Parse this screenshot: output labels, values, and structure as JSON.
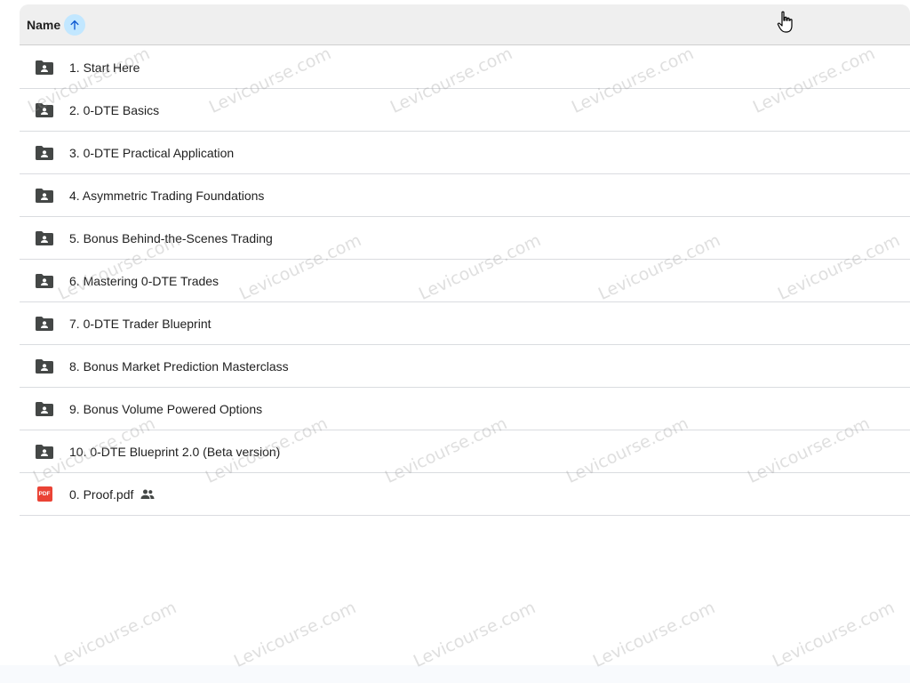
{
  "header": {
    "name_label": "Name"
  },
  "files": [
    {
      "name": "1. Start Here",
      "type": "shared-folder"
    },
    {
      "name": "2. 0-DTE Basics",
      "type": "shared-folder"
    },
    {
      "name": "3. 0-DTE Practical Application",
      "type": "shared-folder"
    },
    {
      "name": "4. Asymmetric Trading Foundations",
      "type": "shared-folder"
    },
    {
      "name": "5. Bonus Behind-the-Scenes Trading",
      "type": "shared-folder"
    },
    {
      "name": "6. Mastering 0-DTE Trades",
      "type": "shared-folder"
    },
    {
      "name": "7. 0-DTE Trader Blueprint",
      "type": "shared-folder"
    },
    {
      "name": "8. Bonus Market Prediction Masterclass",
      "type": "shared-folder"
    },
    {
      "name": "9. Bonus Volume Powered Options",
      "type": "shared-folder"
    },
    {
      "name": "10. 0-DTE Blueprint 2.0 (Beta version)",
      "type": "shared-folder"
    },
    {
      "name": "0. Proof.pdf",
      "type": "pdf",
      "shared": true,
      "pdf_badge": "PDF"
    }
  ],
  "watermark": {
    "text": "Levicourse.com"
  },
  "colors": {
    "sort_button_bg": "#c2e7ff",
    "sort_arrow": "#0b57d0",
    "folder_icon": "#444746",
    "pdf_red": "#ea4335"
  },
  "icons": {
    "sort": "arrow-up-icon",
    "folder": "shared-folder-icon",
    "pdf": "pdf-file-icon",
    "shared": "people-icon",
    "cursor": "hand-pointer-icon"
  }
}
